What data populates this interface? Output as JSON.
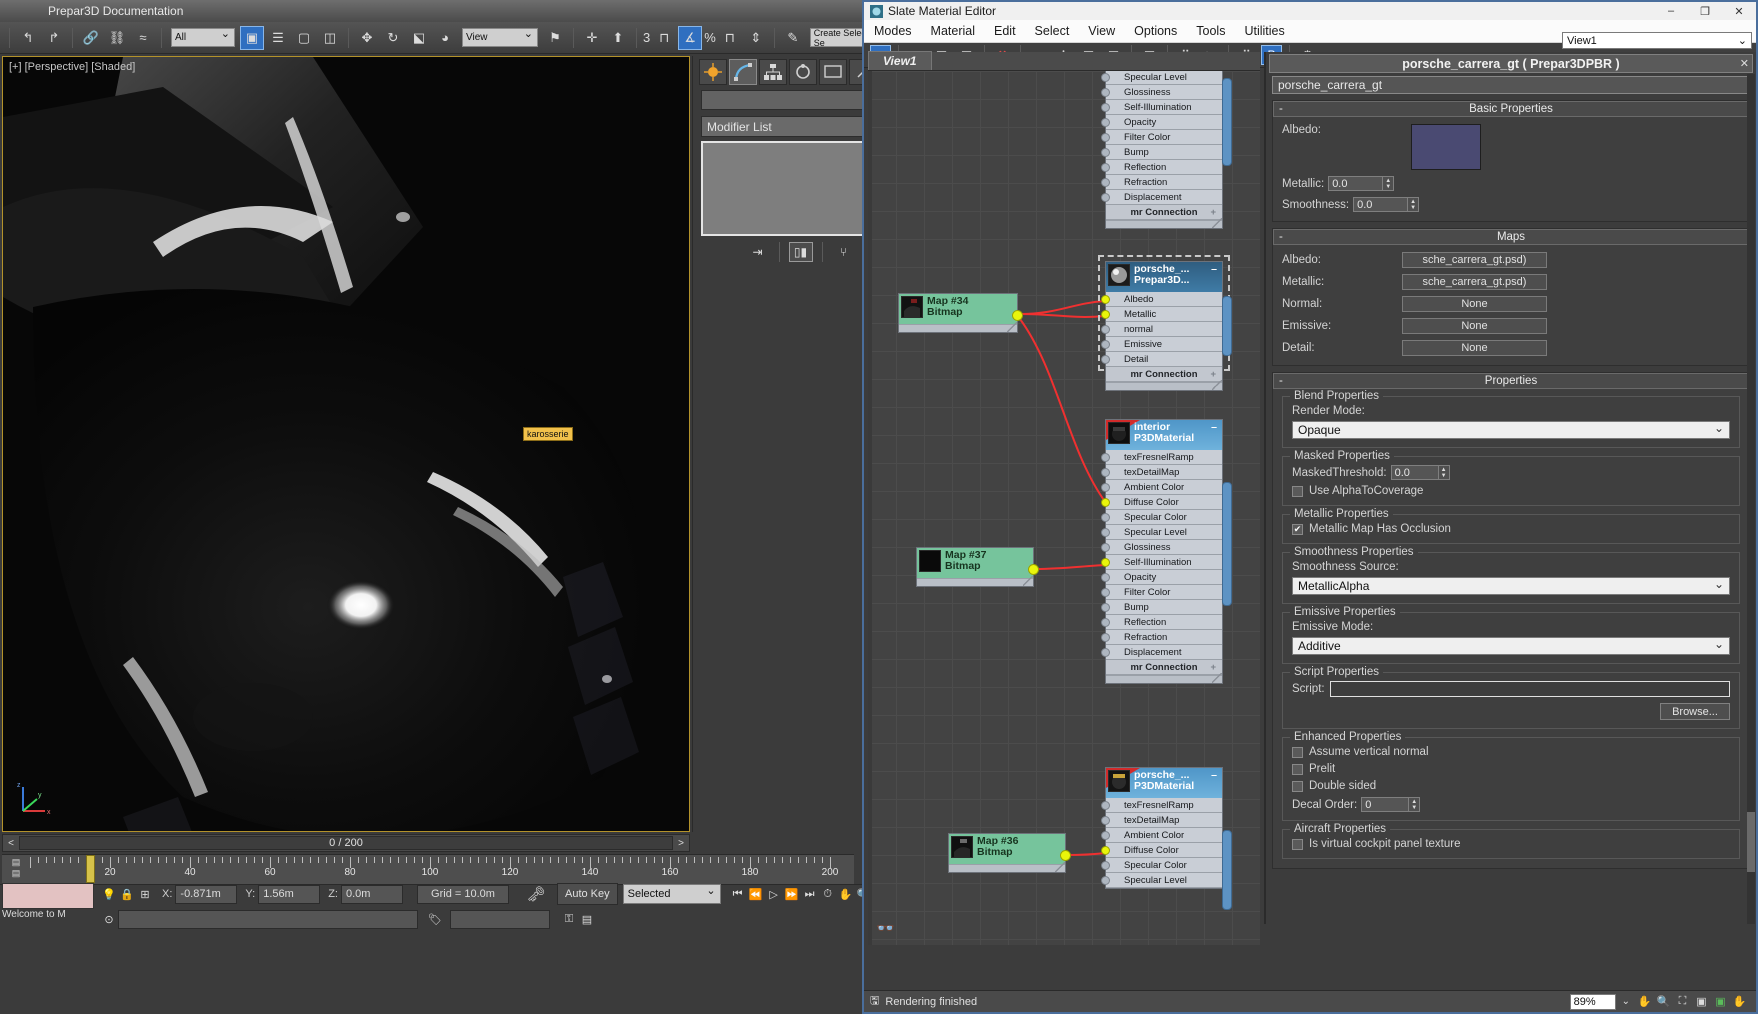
{
  "max": {
    "title": "Prepar3D Documentation",
    "toolbar": {
      "filter_value": "All",
      "view_value": "View",
      "ref_coord_value": "View",
      "selection_set_placeholder": "Create Selection Se",
      "angle_snap_count": "3",
      "percent_symbol": "%"
    },
    "viewport": {
      "label": "[+] [Perspective] [Shaded]",
      "object_tag": "karosserie",
      "axis_x": "x",
      "axis_y": "y",
      "axis_z": "z"
    },
    "command_panel": {
      "modifier_list_label": "Modifier List",
      "name_value": ""
    },
    "timeline": {
      "frame_readout": "0 / 200",
      "prev_arrow": "<",
      "next_arrow": ">",
      "ticks": [
        "20",
        "40",
        "60",
        "80",
        "100",
        "120",
        "140",
        "160",
        "180",
        "200"
      ]
    },
    "status": {
      "listener_text": "Welcome to M",
      "x_label": "X:",
      "x_value": "-0.871m",
      "y_label": "Y:",
      "y_value": "1.56m",
      "z_label": "Z:",
      "z_value": "0.0m",
      "grid_label": "Grid = 10.0m",
      "auto_key_label": "Auto Key",
      "selection_filter_value": "Selected"
    }
  },
  "sme": {
    "title": "Slate Material Editor",
    "window_buttons": {
      "minimize": "–",
      "maximize": "❐",
      "close": "✕"
    },
    "menus": [
      "Modes",
      "Material",
      "Edit",
      "Select",
      "View",
      "Options",
      "Tools",
      "Utilities"
    ],
    "view_combo_value": "View1",
    "active_view_tab": "View1",
    "status_text": "Rendering finished",
    "zoom_value": "89%",
    "nodes": [
      {
        "id": "node-top-material",
        "title_line1": "",
        "title_line2": "",
        "slots": [
          "Specular Level",
          "Glossiness",
          "Self-Illumination",
          "Opacity",
          "Filter Color",
          "Bump",
          "Reflection",
          "Refraction",
          "Displacement"
        ],
        "footer": "mr Connection"
      },
      {
        "id": "node-map34",
        "title_line1": "Map #34",
        "title_line2": "Bitmap"
      },
      {
        "id": "node-porsche-prepar3d",
        "title_line1": "porsche_...",
        "title_line2": "Prepar3D...",
        "slots": [
          "Albedo",
          "Metallic",
          "normal",
          "Emissive",
          "Detail"
        ],
        "connected": [
          "Albedo",
          "Metallic"
        ],
        "footer": "mr Connection"
      },
      {
        "id": "node-interior",
        "title_line1": "interior",
        "title_line2": "P3DMaterial",
        "slots": [
          "texFresnelRamp",
          "texDetailMap",
          "Ambient Color",
          "Diffuse Color",
          "Specular Color",
          "Specular Level",
          "Glossiness",
          "Self-Illumination",
          "Opacity",
          "Filter Color",
          "Bump",
          "Reflection",
          "Refraction",
          "Displacement"
        ],
        "connected": [
          "Diffuse Color",
          "Self-Illumination"
        ],
        "footer": "mr Connection"
      },
      {
        "id": "node-map37",
        "title_line1": "Map #37",
        "title_line2": "Bitmap"
      },
      {
        "id": "node-porsche-p3dmaterial",
        "title_line1": "porsche_...",
        "title_line2": "P3DMaterial",
        "slots": [
          "texFresnelRamp",
          "texDetailMap",
          "Ambient Color",
          "Diffuse Color",
          "Specular Color",
          "Specular Level"
        ],
        "connected": [
          "Diffuse Color"
        ],
        "footer": ""
      },
      {
        "id": "node-map36",
        "title_line1": "Map #36",
        "title_line2": "Bitmap"
      }
    ]
  },
  "params": {
    "header": "porsche_carrera_gt  ( Prepar3DPBR )",
    "close_glyph": "✕",
    "name_value": "porsche_carrera_gt",
    "basic": {
      "title": "Basic Properties",
      "albedo_label": "Albedo:",
      "albedo_color": "#4a4a72",
      "metallic_label": "Metallic:",
      "metallic_value": "0.0",
      "smoothness_label": "Smoothness:",
      "smoothness_value": "0.0"
    },
    "maps": {
      "title": "Maps",
      "rows": [
        {
          "label": "Albedo:",
          "value": "sche_carrera_gt.psd)"
        },
        {
          "label": "Metallic:",
          "value": "sche_carrera_gt.psd)"
        },
        {
          "label": "Normal:",
          "value": "None"
        },
        {
          "label": "Emissive:",
          "value": "None"
        },
        {
          "label": "Detail:",
          "value": "None"
        }
      ]
    },
    "properties": {
      "title": "Properties",
      "blend": {
        "group": "Blend Properties",
        "render_mode_label": "Render Mode:",
        "render_mode_value": "Opaque"
      },
      "masked": {
        "group": "Masked Properties",
        "threshold_label": "MaskedThreshold:",
        "threshold_value": "0.0",
        "alpha_to_coverage_label": "Use AlphaToCoverage",
        "alpha_to_coverage_checked": false
      },
      "metallic": {
        "group": "Metallic Properties",
        "occlusion_label": "Metallic Map Has Occlusion",
        "occlusion_checked": true
      },
      "smoothness": {
        "group": "Smoothness Properties",
        "source_label": "Smoothness Source:",
        "source_value": "MetallicAlpha"
      },
      "emissive": {
        "group": "Emissive Properties",
        "mode_label": "Emissive Mode:",
        "mode_value": "Additive"
      },
      "script": {
        "group": "Script Properties",
        "label": "Script:",
        "value": "",
        "browse_label": "Browse..."
      },
      "enhanced": {
        "group": "Enhanced Properties",
        "assume_vertical_normal": "Assume vertical normal",
        "prelit": "Prelit",
        "double_sided": "Double sided",
        "decal_order_label": "Decal Order:",
        "decal_order_value": "0"
      },
      "aircraft": {
        "group": "Aircraft Properties",
        "vcockpit_label": "Is virtual cockpit panel texture"
      }
    }
  }
}
